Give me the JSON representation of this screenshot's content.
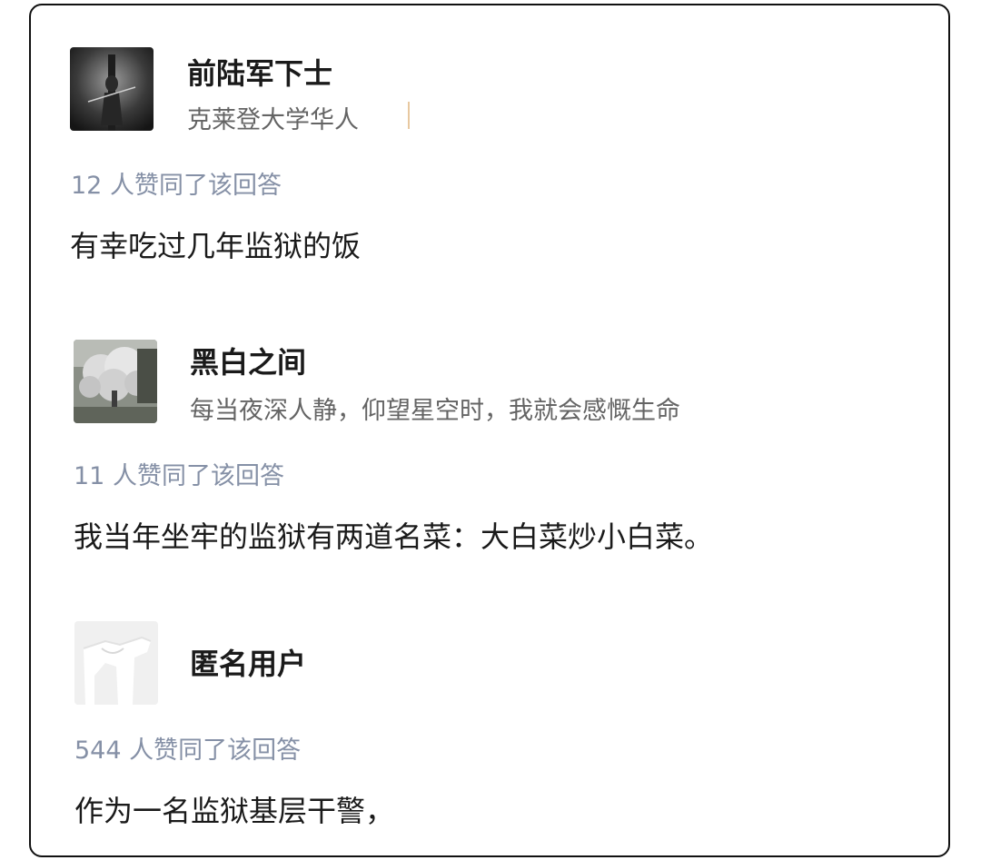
{
  "answers": [
    {
      "author_name": "前陆军下士",
      "author_bio": "克莱登大学华人",
      "avatar_icon": "silhouette-photo-avatar-icon",
      "votes_text": "12 人赞同了该回答",
      "content": "有幸吃过几年监狱的饭"
    },
    {
      "author_name": "黑白之间",
      "author_bio": "每当夜深人静，仰望星空时，我就会感慨生命",
      "avatar_icon": "blossom-tree-avatar-icon",
      "votes_text": "11 人赞同了该回答",
      "content": "我当年坐牢的监狱有两道名菜：大白菜炒小白菜。"
    },
    {
      "author_name": "匿名用户",
      "author_bio": "",
      "avatar_icon": "anonymous-user-avatar-icon",
      "votes_text": "544 人赞同了该回答",
      "content": "作为一名监狱基层干警，"
    }
  ],
  "colors": {
    "name": "#1a1a1a",
    "bio": "#646464",
    "votes": "#8590a6",
    "content": "#1a1a1a",
    "border": "#111111"
  }
}
